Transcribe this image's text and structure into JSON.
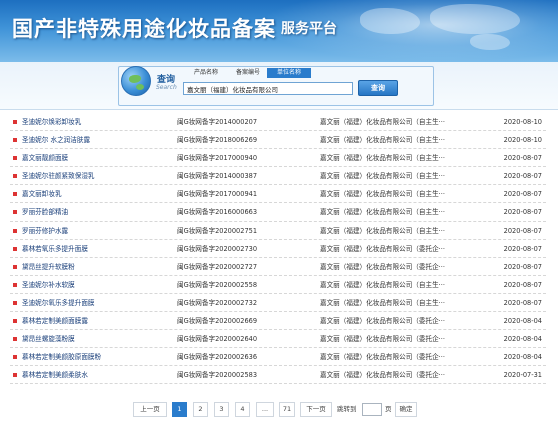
{
  "banner": {
    "title": "国产非特殊用途化妆品备案",
    "subtitle": "服务平台"
  },
  "search": {
    "label": "查询",
    "label_en": "Search",
    "tabs": [
      {
        "label": "产品名称",
        "active": false
      },
      {
        "label": "备案编号",
        "active": false
      },
      {
        "label": "单位名称",
        "active": true
      }
    ],
    "value": "嘉文丽（福建）化妆品有限公司",
    "button": "查询"
  },
  "rows": [
    {
      "name": "圣迪妮尔焕彩卸妆乳",
      "code": "闽G妆网备字2014000207",
      "company": "嘉文丽（福建）化妆品有限公司（自主生···",
      "date": "2020-08-10"
    },
    {
      "name": "圣迪妮尔 水之润洁肤露",
      "code": "闽G妆网备字2018006269",
      "company": "嘉文丽（福建）化妆品有限公司（自主生···",
      "date": "2020-08-10"
    },
    {
      "name": "嘉文丽靓颜面膜",
      "code": "闽G妆网备字2017000940",
      "company": "嘉文丽（福建）化妆品有限公司（自主生···",
      "date": "2020-08-07"
    },
    {
      "name": "圣迪妮尔驻颜紧致保湿乳",
      "code": "闽G妆网备字2014000387",
      "company": "嘉文丽（福建）化妆品有限公司（自主生···",
      "date": "2020-08-07"
    },
    {
      "name": "嘉文丽卸妆乳",
      "code": "闽G妆网备字2017000941",
      "company": "嘉文丽（福建）化妆品有限公司（自主生···",
      "date": "2020-08-07"
    },
    {
      "name": "罗丽芬脸部精油",
      "code": "闽G妆网备字2016000663",
      "company": "嘉文丽（福建）化妆品有限公司（自主生···",
      "date": "2020-08-07"
    },
    {
      "name": "罗丽芬修护水露",
      "code": "闽G妆网备字2020002751",
      "company": "嘉文丽（福建）化妆品有限公司（自主生···",
      "date": "2020-08-07"
    },
    {
      "name": "慕林若氧乐多提升面膜",
      "code": "闽G妆网备字2020002730",
      "company": "嘉文丽（福建）化妆品有限公司（委托企···",
      "date": "2020-08-07"
    },
    {
      "name": "黛昂丝提升软膜粉",
      "code": "闽G妆网备字2020002727",
      "company": "嘉文丽（福建）化妆品有限公司（委托企···",
      "date": "2020-08-07"
    },
    {
      "name": "圣迪妮尔补水软膜",
      "code": "闽G妆网备字2020002558",
      "company": "嘉文丽（福建）化妆品有限公司（自主生···",
      "date": "2020-08-07"
    },
    {
      "name": "圣迪妮尔氧乐多提升面膜",
      "code": "闽G妆网备字2020002732",
      "company": "嘉文丽（福建）化妆品有限公司（自主生···",
      "date": "2020-08-07"
    },
    {
      "name": "慕林若定制美颜面膜露",
      "code": "闽G妆网备字2020002669",
      "company": "嘉文丽（福建）化妆品有限公司（委托企···",
      "date": "2020-08-04"
    },
    {
      "name": "黛昂丝螺旋藻粉膜",
      "code": "闽G妆网备字2020002640",
      "company": "嘉文丽（福建）化妆品有限公司（委托企···",
      "date": "2020-08-04"
    },
    {
      "name": "慕林若定制美颜胶原面膜粉",
      "code": "闽G妆网备字2020002636",
      "company": "嘉文丽（福建）化妆品有限公司（委托企···",
      "date": "2020-08-04"
    },
    {
      "name": "慕林若定制美颜柔肤水",
      "code": "闽G妆网备字2020002583",
      "company": "嘉文丽（福建）化妆品有限公司（委托企···",
      "date": "2020-07-31"
    }
  ],
  "pager": {
    "prev": "上一页",
    "pages": [
      "1",
      "2",
      "3",
      "4"
    ],
    "ellipsis": "...",
    "last": "71",
    "next": "下一页",
    "goto_prefix": "跳转到",
    "goto_suffix": "页",
    "confirm": "确定",
    "current": "1"
  },
  "colors": {
    "accent": "#2a7ccc",
    "bullet": "#dd3333",
    "link": "#1a3f7a"
  }
}
